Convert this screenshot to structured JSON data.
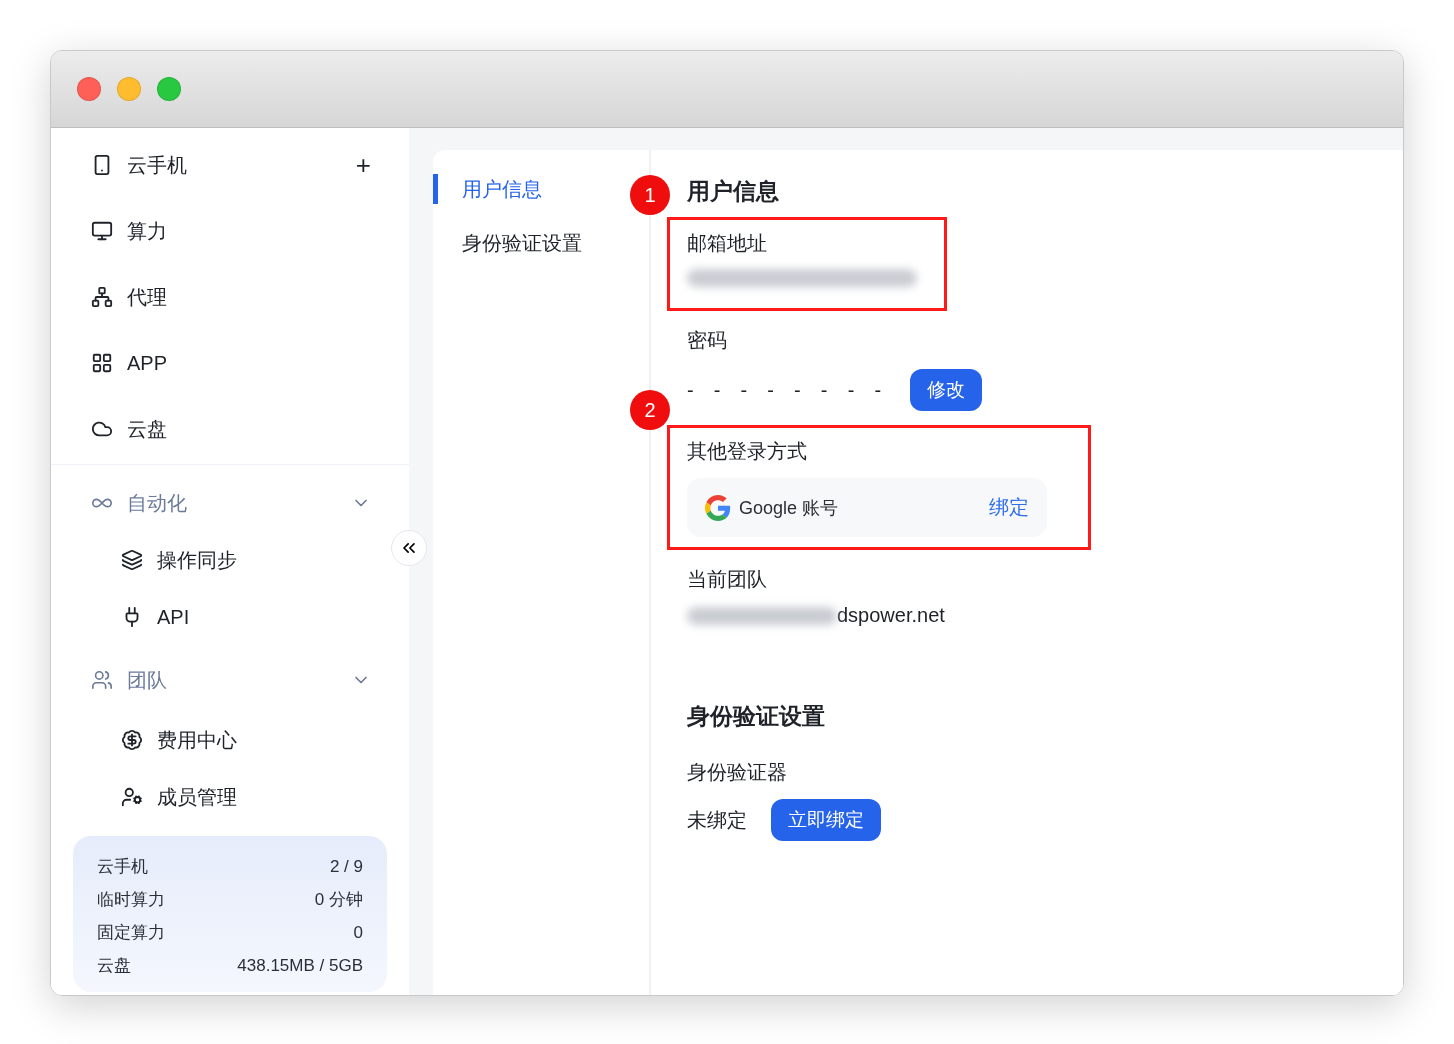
{
  "sidebar": {
    "items": [
      {
        "label": "云手机",
        "action": "+"
      },
      {
        "label": "算力"
      },
      {
        "label": "代理"
      },
      {
        "label": "APP"
      },
      {
        "label": "云盘"
      }
    ],
    "groups": [
      {
        "label": "自动化",
        "expanded": true,
        "children": [
          "操作同步",
          "API"
        ]
      },
      {
        "label": "团队",
        "expanded": true,
        "children": [
          "费用中心",
          "成员管理"
        ]
      }
    ],
    "usage": [
      {
        "label": "云手机",
        "value": "2 / 9"
      },
      {
        "label": "临时算力",
        "value": "0 分钟"
      },
      {
        "label": "固定算力",
        "value": "0"
      },
      {
        "label": "云盘",
        "value": "438.15MB / 5GB"
      }
    ]
  },
  "settings_nav": [
    {
      "label": "用户信息",
      "selected": true
    },
    {
      "label": "身份验证设置",
      "selected": false
    }
  ],
  "user_info": {
    "title": "用户信息",
    "marker": "1",
    "email": {
      "label": "邮箱地址",
      "blurred": true
    },
    "password": {
      "label": "密码",
      "mask": "-  -  -  -  -  -  -  -",
      "button": "修改"
    },
    "other_login": {
      "label": "其他登录方式",
      "marker": "2",
      "provider": "Google 账号",
      "action": "绑定"
    },
    "team": {
      "label": "当前团队",
      "value": "dspower.net",
      "blurred_prefix": true
    }
  },
  "auth": {
    "title": "身份验证设置",
    "label": "身份验证器",
    "status": "未绑定",
    "button": "立即绑定"
  }
}
